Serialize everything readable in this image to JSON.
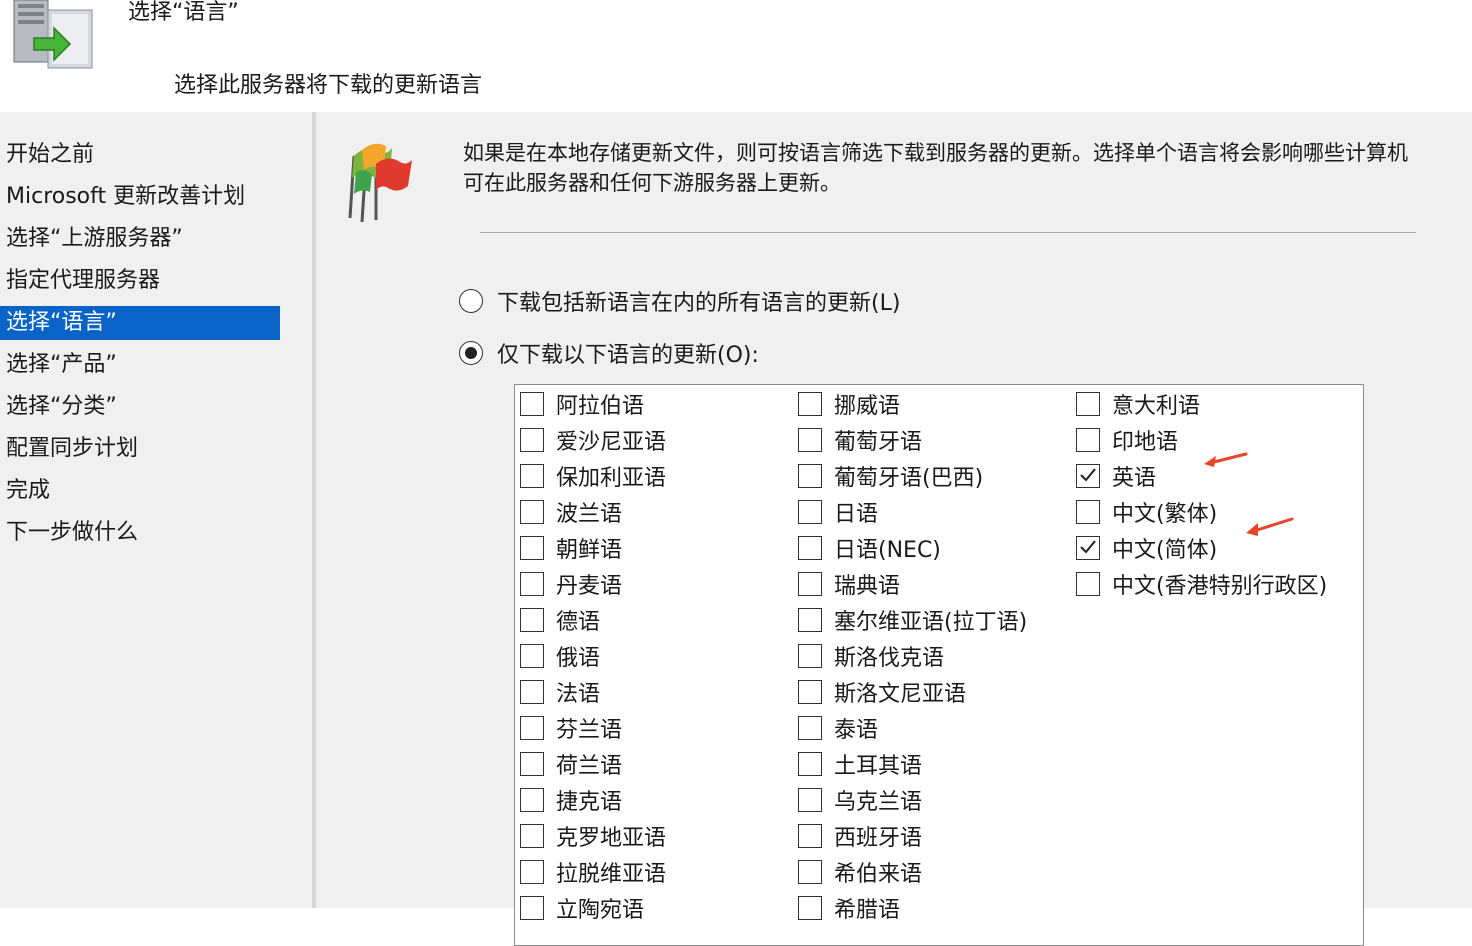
{
  "header": {
    "title": "选择“语言”",
    "subtitle": "选择此服务器将下载的更新语言"
  },
  "sidebar": {
    "items": [
      {
        "label": "开始之前",
        "active": false
      },
      {
        "label": "Microsoft 更新改善计划",
        "active": false
      },
      {
        "label": "选择“上游服务器”",
        "active": false
      },
      {
        "label": "指定代理服务器",
        "active": false
      },
      {
        "label": "选择“语言”",
        "active": true
      },
      {
        "label": "选择“产品”",
        "active": false
      },
      {
        "label": "选择“分类”",
        "active": false
      },
      {
        "label": "配置同步计划",
        "active": false
      },
      {
        "label": "完成",
        "active": false
      },
      {
        "label": "下一步做什么",
        "active": false
      }
    ]
  },
  "main": {
    "description": "如果是在本地存储更新文件，则可按语言筛选下载到服务器的更新。选择单个语言将会影响哪些计算机可在此服务器和任何下游服务器上更新。",
    "option_all": {
      "label": "下载包括新语言在内的所有语言的更新(L)",
      "selected": false
    },
    "option_only": {
      "label": "仅下载以下语言的更新(O):",
      "selected": true
    },
    "languages": {
      "col1": [
        {
          "label": "阿拉伯语",
          "checked": false
        },
        {
          "label": "爱沙尼亚语",
          "checked": false
        },
        {
          "label": "保加利亚语",
          "checked": false
        },
        {
          "label": "波兰语",
          "checked": false
        },
        {
          "label": "朝鲜语",
          "checked": false
        },
        {
          "label": "丹麦语",
          "checked": false
        },
        {
          "label": "德语",
          "checked": false
        },
        {
          "label": "俄语",
          "checked": false
        },
        {
          "label": "法语",
          "checked": false
        },
        {
          "label": "芬兰语",
          "checked": false
        },
        {
          "label": "荷兰语",
          "checked": false
        },
        {
          "label": "捷克语",
          "checked": false
        },
        {
          "label": "克罗地亚语",
          "checked": false
        },
        {
          "label": "拉脱维亚语",
          "checked": false
        },
        {
          "label": "立陶宛语",
          "checked": false
        }
      ],
      "col2": [
        {
          "label": "挪威语",
          "checked": false
        },
        {
          "label": "葡萄牙语",
          "checked": false
        },
        {
          "label": "葡萄牙语(巴西)",
          "checked": false
        },
        {
          "label": "日语",
          "checked": false
        },
        {
          "label": "日语(NEC)",
          "checked": false
        },
        {
          "label": "瑞典语",
          "checked": false
        },
        {
          "label": "塞尔维亚语(拉丁语)",
          "checked": false
        },
        {
          "label": "斯洛伐克语",
          "checked": false
        },
        {
          "label": "斯洛文尼亚语",
          "checked": false
        },
        {
          "label": "泰语",
          "checked": false
        },
        {
          "label": "土耳其语",
          "checked": false
        },
        {
          "label": "乌克兰语",
          "checked": false
        },
        {
          "label": "西班牙语",
          "checked": false
        },
        {
          "label": "希伯来语",
          "checked": false
        },
        {
          "label": "希腊语",
          "checked": false
        }
      ],
      "col3": [
        {
          "label": "意大利语",
          "checked": false
        },
        {
          "label": "印地语",
          "checked": false
        },
        {
          "label": "英语",
          "checked": true
        },
        {
          "label": "中文(繁体)",
          "checked": false
        },
        {
          "label": "中文(简体)",
          "checked": true
        },
        {
          "label": "中文(香港特别行政区)",
          "checked": false
        }
      ]
    }
  },
  "colors": {
    "active_item": "#0a64c8",
    "annotation_arrow": "#e8442a",
    "panel_bg": "#f0f0f0"
  }
}
